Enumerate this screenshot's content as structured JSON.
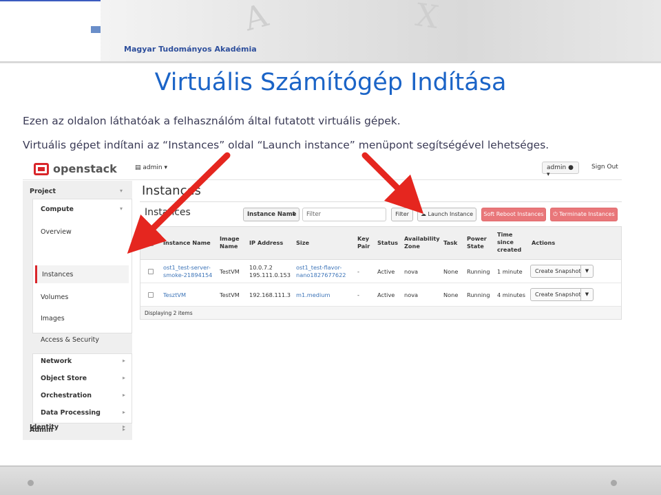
{
  "slide": {
    "academy": "Magyar Tudományos Akadémia",
    "title": "Virtuális Számítógép Indítása",
    "line1": "Ezen az oldalon láthatóak a felhasználóm által futatott virtuális gépek.",
    "line2": "Virtuális gépet indítani az “Instances” oldal “Launch instance” menüpont segítségével lehetséges."
  },
  "topbar": {
    "logo": "openstack",
    "project_selector": "admin",
    "user": "admin",
    "signout": "Sign Out"
  },
  "sidebar": {
    "project": "Project",
    "compute": "Compute",
    "items": [
      "Overview",
      "Instances",
      "Volumes",
      "Images",
      "Access & Security"
    ],
    "groups": [
      "Network",
      "Object Store",
      "Orchestration",
      "Data Processing"
    ],
    "admin": "Admin",
    "identity": "Identity"
  },
  "page": {
    "heading": "Instances",
    "subheading": "Instances",
    "filter_field": "Instance Name",
    "filter_placeholder": "Filter",
    "filter_button": "Filter",
    "launch_button": "Launch Instance",
    "soft_reboot_button": "Soft Reboot Instances",
    "terminate_button": "Terminate Instances"
  },
  "table": {
    "headers": {
      "instance_name": "Instance Name",
      "image_1": "Image",
      "image_2": "Name",
      "ip": "IP Address",
      "size": "Size",
      "key_1": "Key",
      "key_2": "Pair",
      "status": "Status",
      "zone_1": "Availability",
      "zone_2": "Zone",
      "task": "Task",
      "power_1": "Power",
      "power_2": "State",
      "time_1": "Time",
      "time_2": "since",
      "time_3": "created",
      "actions": "Actions"
    },
    "rows": [
      {
        "name_1": "ost1_test-server-",
        "name_2": "smoke-21894154",
        "image": "TestVM",
        "ip_1": "10.0.7.2",
        "ip_2": "195.111.0.153",
        "size_1": "ost1_test-flavor-",
        "size_2": "nano1827677622",
        "key": "-",
        "status": "Active",
        "zone": "nova",
        "task": "None",
        "power": "Running",
        "time": "1 minute",
        "action": "Create Snapshot"
      },
      {
        "name_1": "TesztVM",
        "name_2": "",
        "image": "TestVM",
        "ip_1": "192.168.111.3",
        "ip_2": "",
        "size_1": "m1.medium",
        "size_2": "",
        "key": "-",
        "status": "Active",
        "zone": "nova",
        "task": "None",
        "power": "Running",
        "time": "4 minutes",
        "action": "Create Snapshot"
      }
    ],
    "footer": "Displaying 2 items"
  },
  "colors": {
    "title_blue": "#1b64c7",
    "openstack_red": "#d9252a",
    "danger_button": "#e9777a",
    "link_blue": "#3c74b8",
    "arrow_red": "#e5261f"
  }
}
